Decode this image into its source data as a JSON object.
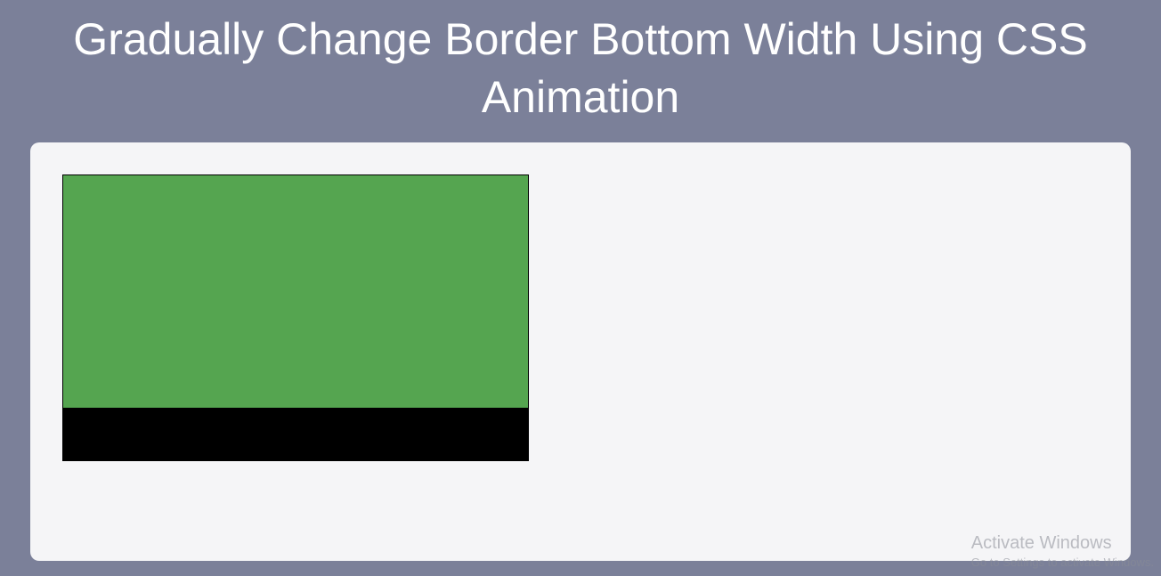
{
  "title": "Gradually Change Border Bottom Width Using CSS Animation",
  "watermark": {
    "title": "Activate Windows",
    "subtitle": "Go to Settings to activate Windows."
  }
}
